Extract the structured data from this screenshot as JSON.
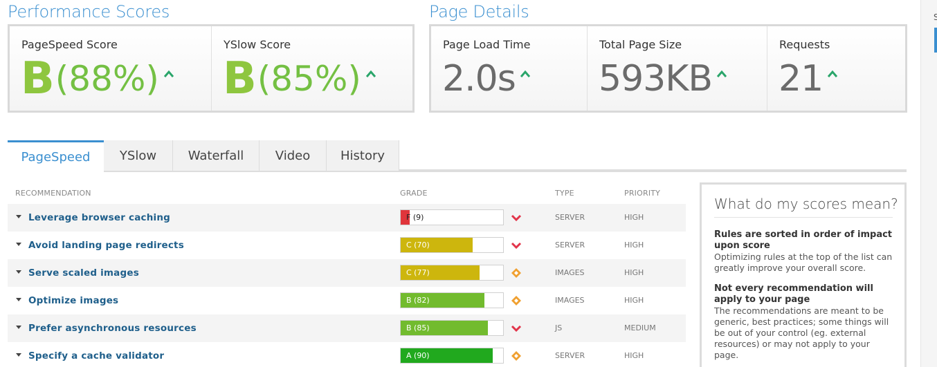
{
  "performance": {
    "title": "Performance Scores",
    "pagespeed": {
      "label": "PageSpeed Score",
      "grade": "B",
      "percent": "(88%)"
    },
    "yslow": {
      "label": "YSlow Score",
      "grade": "B",
      "percent": "(85%)"
    }
  },
  "details": {
    "title": "Page Details",
    "load_time": {
      "label": "Page Load Time",
      "value": "2.0s"
    },
    "page_size": {
      "label": "Total Page Size",
      "value": "593KB"
    },
    "requests": {
      "label": "Requests",
      "value": "21"
    }
  },
  "tabs": [
    "PageSpeed",
    "YSlow",
    "Waterfall",
    "Video",
    "History"
  ],
  "table": {
    "headers": {
      "recommendation": "RECOMMENDATION",
      "grade": "GRADE",
      "type": "TYPE",
      "priority": "PRIORITY"
    },
    "rows": [
      {
        "name": "Leverage browser caching",
        "grade": "F (9)",
        "score": 9,
        "color": "#e0353b",
        "trend": "down",
        "type": "SERVER",
        "priority": "HIGH"
      },
      {
        "name": "Avoid landing page redirects",
        "grade": "C (70)",
        "score": 70,
        "color": "#cdb60d",
        "trend": "down",
        "type": "SERVER",
        "priority": "HIGH"
      },
      {
        "name": "Serve scaled images",
        "grade": "C (77)",
        "score": 77,
        "color": "#cdb60d",
        "trend": "neutral",
        "type": "IMAGES",
        "priority": "HIGH"
      },
      {
        "name": "Optimize images",
        "grade": "B (82)",
        "score": 82,
        "color": "#72bb2e",
        "trend": "neutral",
        "type": "IMAGES",
        "priority": "HIGH"
      },
      {
        "name": "Prefer asynchronous resources",
        "grade": "B (85)",
        "score": 85,
        "color": "#72bb2e",
        "trend": "down",
        "type": "JS",
        "priority": "MEDIUM"
      },
      {
        "name": "Specify a cache validator",
        "grade": "A (90)",
        "score": 90,
        "color": "#21a91e",
        "trend": "neutral",
        "type": "SERVER",
        "priority": "HIGH"
      }
    ]
  },
  "sidebar": {
    "title": "What do my scores mean?",
    "h1": "Rules are sorted in order of impact upon score",
    "p1": "Optimizing rules at the top of the list can greatly improve your overall score.",
    "h2": "Not every recommendation will apply to your page",
    "p2": "The recommendations are meant to be generic, best practices; some things will be out of your control (eg. external resources) or may not apply to your page."
  },
  "scrollbar": {
    "char": "S"
  },
  "colors": {
    "accent": "#3a8fd0",
    "up_arrow": "#2aa56a",
    "down_arrow": "#e2344a",
    "neutral_diamond": "#f0a030"
  }
}
